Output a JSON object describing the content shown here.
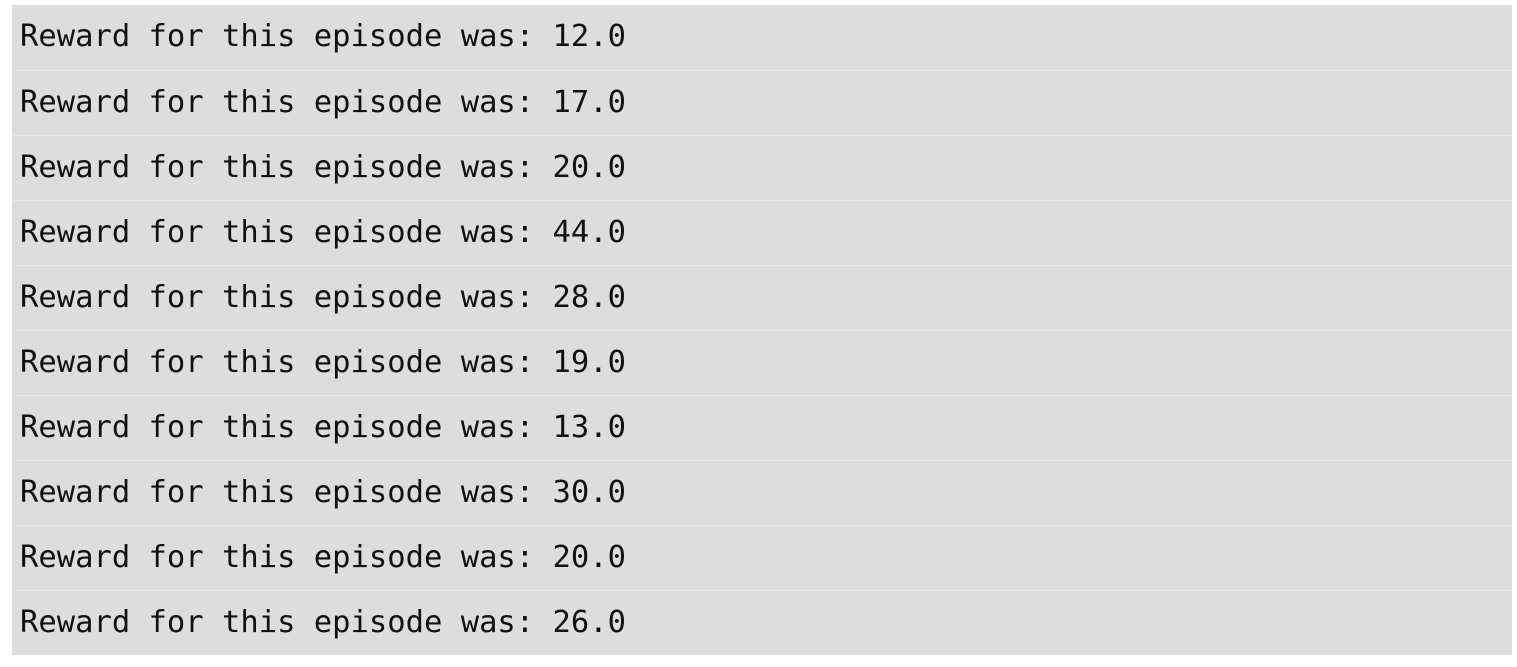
{
  "console": {
    "lines": [
      "Reward for this episode was: 12.0",
      "Reward for this episode was: 17.0",
      "Reward for this episode was: 20.0",
      "Reward for this episode was: 44.0",
      "Reward for this episode was: 28.0",
      "Reward for this episode was: 19.0",
      "Reward for this episode was: 13.0",
      "Reward for this episode was: 30.0",
      "Reward for this episode was: 20.0",
      "Reward for this episode was: 26.0"
    ]
  }
}
